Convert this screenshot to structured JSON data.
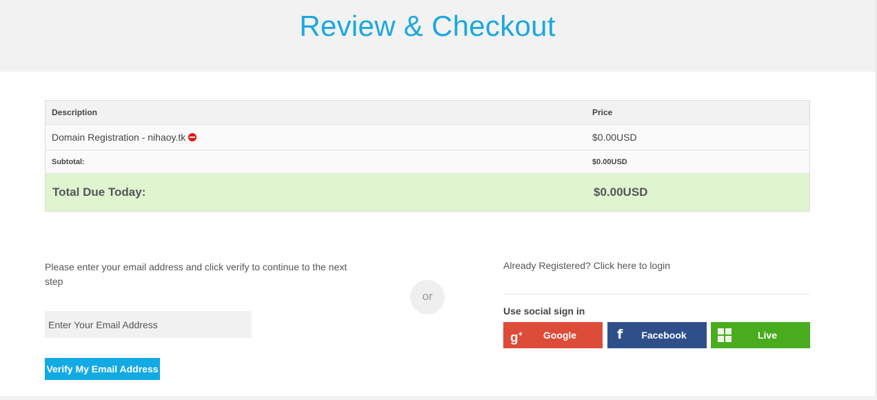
{
  "page": {
    "title": "Review & Checkout"
  },
  "cart": {
    "headers": {
      "description": "Description",
      "price": "Price"
    },
    "items": [
      {
        "description": "Domain Registration - nihaoy.tk",
        "price": "$0.00USD"
      }
    ],
    "subtotal": {
      "label": "Subtotal:",
      "value": "$0.00USD"
    },
    "total": {
      "label": "Total Due Today:",
      "value": "$0.00USD"
    }
  },
  "email_verify": {
    "intro": "Please enter your email address and click verify to continue to the next step",
    "placeholder": "Enter Your Email Address",
    "button": "Verify My Email Address"
  },
  "or_label": "or",
  "login": {
    "link": "Already Registered? Click here to login",
    "social_title": "Use social sign in",
    "buttons": [
      {
        "label": "Google",
        "icon": "google-plus-icon",
        "color": "#dd4b39"
      },
      {
        "label": "Facebook",
        "icon": "facebook-icon",
        "color": "#2f4f8a"
      },
      {
        "label": "Live",
        "icon": "windows-icon",
        "color": "#49ac1f"
      }
    ]
  },
  "colors": {
    "accent": "#1ba8e0",
    "total_bg": "#dff5d0",
    "verify_button": "#12a9e4"
  }
}
